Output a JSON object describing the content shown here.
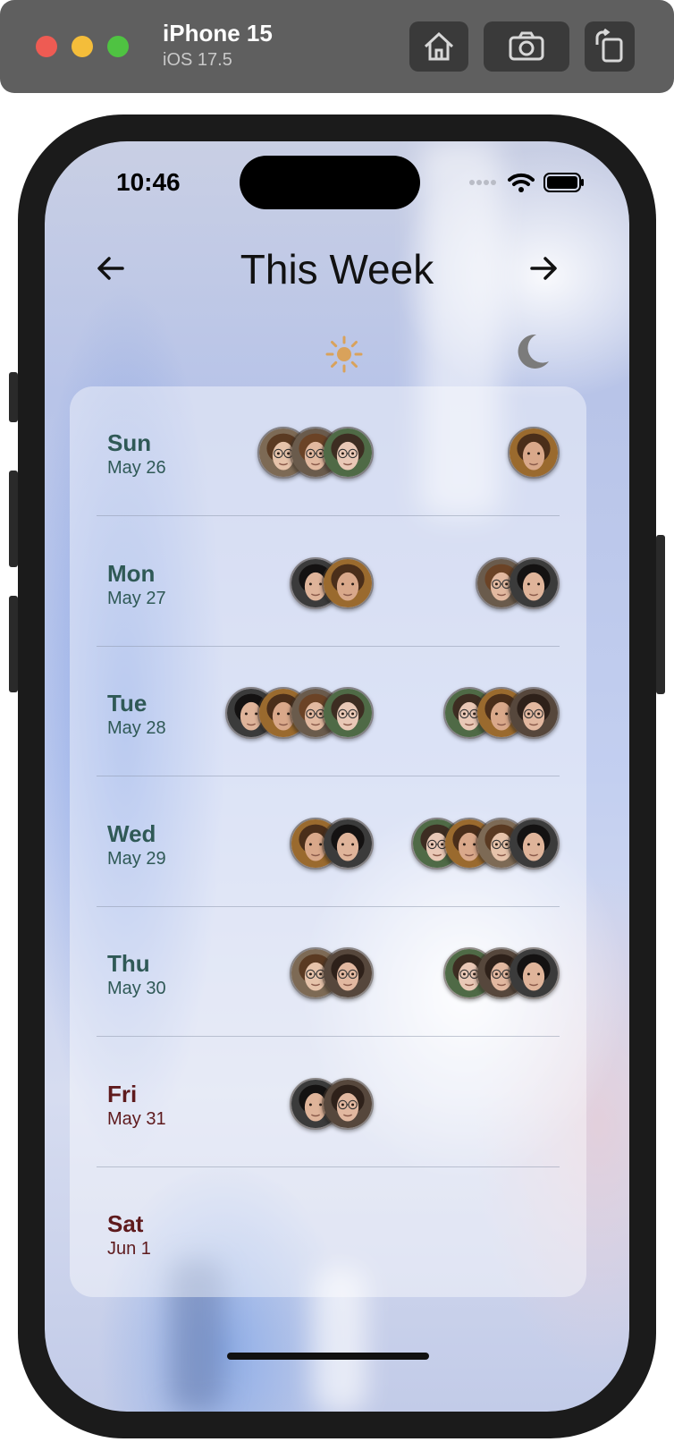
{
  "simulator": {
    "device_name": "iPhone 15",
    "os_version": "iOS 17.5",
    "buttons": [
      "home-icon",
      "screenshot-icon",
      "rotate-icon"
    ]
  },
  "status_bar": {
    "time": "10:46",
    "icons": [
      "signal-dots-icon",
      "wifi-icon",
      "battery-icon"
    ]
  },
  "header": {
    "title": "This Week",
    "prev_icon": "arrow-left-icon",
    "next_icon": "arrow-right-icon"
  },
  "columns": {
    "day_icon": "sun-icon",
    "night_icon": "moon-icon",
    "day_icon_color": "#d9a25b",
    "night_icon_color": "#7b7b7b"
  },
  "colors": {
    "weekday_text": "#2f5956",
    "weekend_text": "#5e1a1d"
  },
  "days": [
    {
      "name": "Sun",
      "date": "May 26",
      "weekend": false,
      "day_people": [
        "p-young-woman-glasses",
        "p-woman-glasses",
        "p-woman-long-hair"
      ],
      "night_people": [
        "p-curly-man"
      ]
    },
    {
      "name": "Mon",
      "date": "May 27",
      "weekend": false,
      "day_people": [
        "p-dark-haired-man",
        "p-curly-man"
      ],
      "night_people": [
        "p-woman-glasses",
        "p-dark-haired-man"
      ]
    },
    {
      "name": "Tue",
      "date": "May 28",
      "weekend": false,
      "day_people": [
        "p-dark-haired-man",
        "p-curly-man",
        "p-woman-glasses",
        "p-woman-long-hair"
      ],
      "night_people": [
        "p-woman-long-hair",
        "p-curly-man",
        "p-curly-woman"
      ]
    },
    {
      "name": "Wed",
      "date": "May 29",
      "weekend": false,
      "day_people": [
        "p-curly-man",
        "p-dark-haired-man"
      ],
      "night_people": [
        "p-woman-long-hair",
        "p-curly-man",
        "p-young-woman-glasses",
        "p-dark-haired-man"
      ]
    },
    {
      "name": "Thu",
      "date": "May 30",
      "weekend": false,
      "day_people": [
        "p-young-woman-glasses",
        "p-curly-woman"
      ],
      "night_people": [
        "p-woman-long-hair",
        "p-curly-woman",
        "p-dark-haired-man"
      ]
    },
    {
      "name": "Fri",
      "date": "May 31",
      "weekend": true,
      "day_people": [
        "p-dark-haired-man",
        "p-curly-woman"
      ],
      "night_people": []
    },
    {
      "name": "Sat",
      "date": "Jun 1",
      "weekend": true,
      "day_people": [],
      "night_people": []
    }
  ]
}
